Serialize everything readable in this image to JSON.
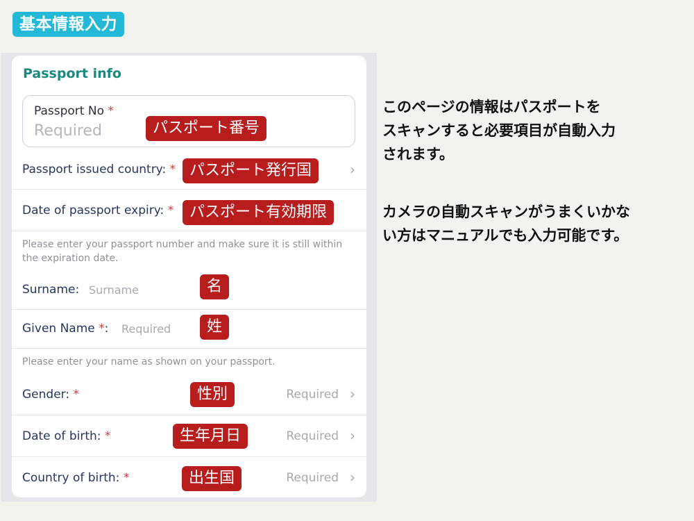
{
  "header_tag": "基本情報入力",
  "card": {
    "title": "Passport info",
    "passport_no": {
      "label": "Passport No",
      "required_mark": "*",
      "placeholder": "Required"
    },
    "rows": {
      "issued_country": {
        "label": "Passport issued country:",
        "required_mark": "*"
      },
      "expiry": {
        "label": "Date of passport expiry:",
        "required_mark": "*"
      },
      "passport_note": "Please enter your passport number and make sure it is still within the expiration date.",
      "surname": {
        "label": "Surname:",
        "placeholder": "Surname"
      },
      "given_name": {
        "label": "Given Name",
        "required_mark": "*",
        "suffix": ":",
        "placeholder": "Required"
      },
      "name_note": "Please enter your name as shown on your passport.",
      "gender": {
        "label": "Gender:",
        "required_mark": "*",
        "value": "Required"
      },
      "dob": {
        "label": "Date of birth:",
        "required_mark": "*",
        "value": "Required"
      },
      "country_of_birth": {
        "label": "Country of birth:",
        "required_mark": "*",
        "value": "Required"
      }
    }
  },
  "badges": {
    "passport_no": "パスポート番号",
    "issued_country": "パスポート発行国",
    "expiry": "パスポート有効期限",
    "surname": "名",
    "given_name": "姓",
    "gender": "性別",
    "dob": "生年月日",
    "country_of_birth": "出生国"
  },
  "side_text": {
    "para1": [
      "このページの情報はパスポートを",
      "スキャンすると必要項目が自動入力",
      "されます。"
    ],
    "para2": [
      "カメラの自動スキャンがうまくいかな",
      "い方はマニュアルでも入力可能です。"
    ]
  },
  "colors": {
    "header_tag_bg": "#22b8d6",
    "badge_bg": "#b81d1d",
    "title_teal": "#1a8a80",
    "label_navy": "#253760",
    "required_red": "#d63b3b"
  },
  "icons": {
    "chevron": "chevron-right-icon"
  }
}
